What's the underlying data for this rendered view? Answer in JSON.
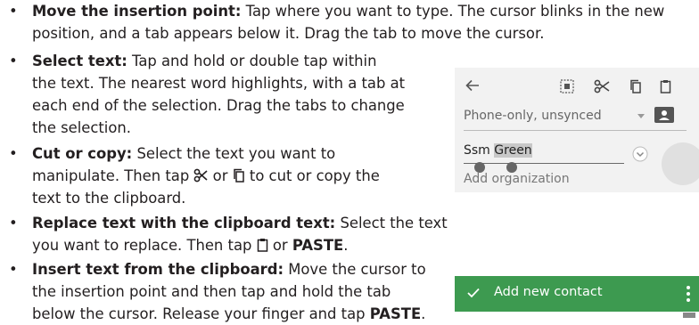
{
  "instructions": [
    {
      "bold": "Move the insertion point:",
      "lines": [
        "Tap where you want to type. The cursor blinks in the new",
        "position, and a tab appears below it. Drag the tab to move the cursor."
      ]
    },
    {
      "bold": "Select text:",
      "lines": [
        "Tap and hold or double tap within",
        "the text. The nearest word highlights, with a tab at",
        "each end of the selection. Drag the tabs to change",
        "the selection."
      ]
    },
    {
      "bold": "Cut or copy:",
      "line1": "Select the text you want to",
      "line2_a": "manipulate. Then tap",
      "line2_b": "or",
      "line2_c": "to cut or copy the",
      "line3": "text to the clipboard."
    },
    {
      "bold": "Replace text with the clipboard text:",
      "line1": "Select the text",
      "line2_a": "you want to replace. Then tap",
      "line2_b": "or",
      "line2_bold": "PASTE",
      "line2_end": "."
    },
    {
      "bold": "Insert text from the clipboard:",
      "line1": "Move the cursor to",
      "line2": "the insertion point and then tap and hold the tab",
      "line3_a": "below the cursor. Release your finger and tap",
      "line3_bold": "PASTE",
      "line3_end": "."
    }
  ],
  "screen1": {
    "account": "Phone-only, unsynced",
    "name_plain": "Ssm",
    "name_selected": "Green",
    "organization_placeholder": "Add organization"
  },
  "screen2": {
    "title": "Add new contact"
  }
}
